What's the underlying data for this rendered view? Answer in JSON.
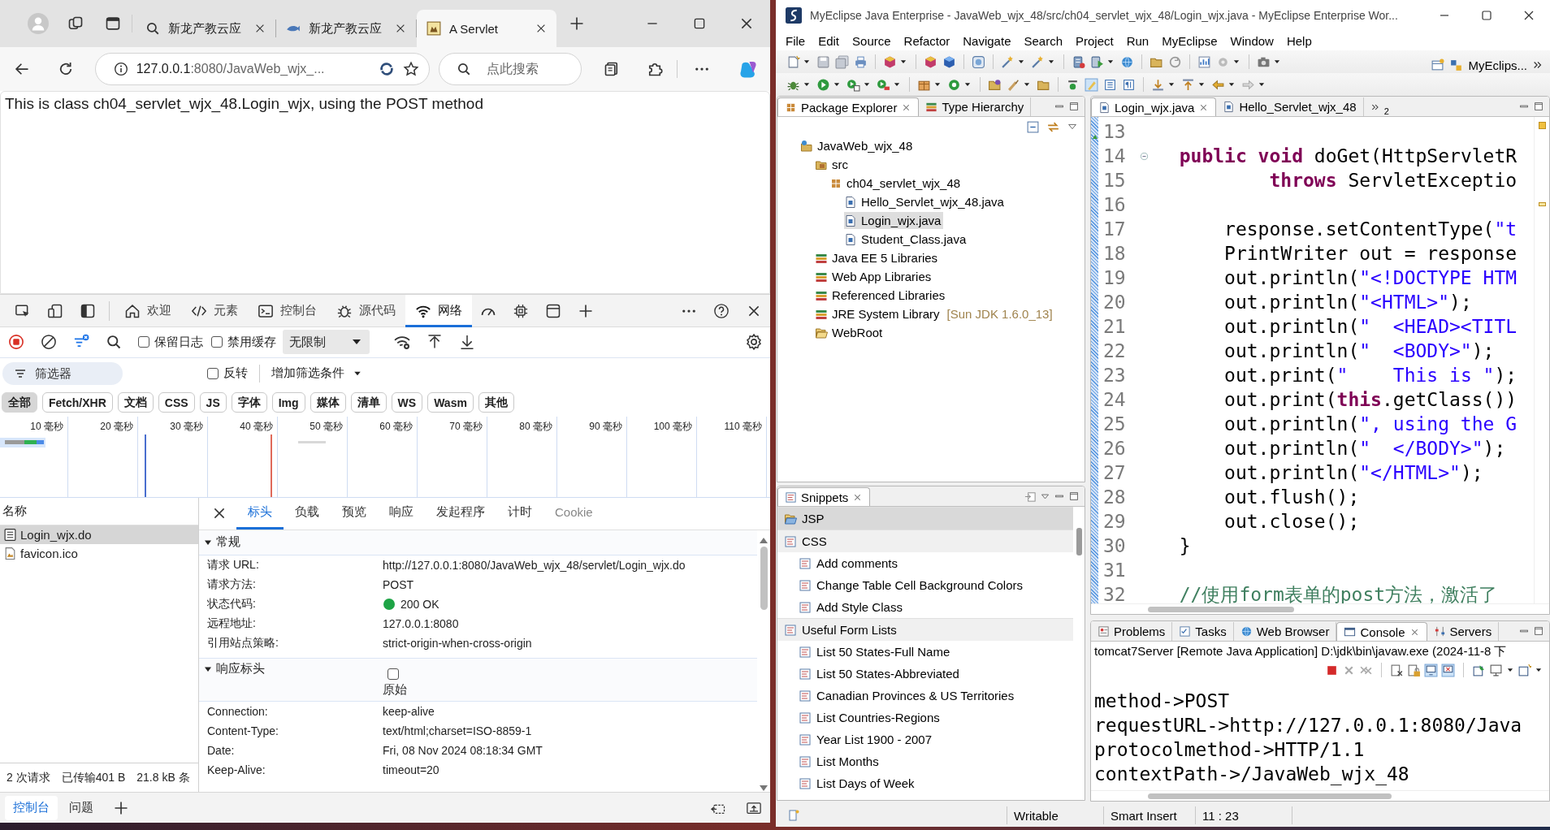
{
  "browser": {
    "tabs": [
      {
        "title": "新龙产教云应",
        "kind": "search",
        "selected": false
      },
      {
        "title": "新龙产教云应",
        "kind": "fish",
        "selected": false
      },
      {
        "title": "A Servlet",
        "kind": "favicon",
        "selected": true
      }
    ],
    "address": {
      "host": "127.0.0.1",
      "path": ":8080/JavaWeb_wjx_..."
    },
    "search": {
      "placeholder": "点此搜索"
    },
    "page_text": "This is class ch04_servlet_wjx_48.Login_wjx, using the POST method"
  },
  "devtools": {
    "tabs": [
      {
        "label": "欢迎",
        "kind": "home",
        "selected": false
      },
      {
        "label": "元素",
        "kind": "code",
        "selected": false
      },
      {
        "label": "控制台",
        "kind": "console",
        "selected": false
      },
      {
        "label": "源代码",
        "kind": "bug",
        "selected": false
      },
      {
        "label": "网络",
        "kind": "wifi",
        "selected": true
      }
    ],
    "preserve_log": {
      "label": "保留日志",
      "checked": false
    },
    "disable_cache": {
      "label": "禁用缓存",
      "checked": false
    },
    "throttling": "无限制",
    "filter": {
      "placeholder": "筛选器"
    },
    "invert": {
      "label": "反转",
      "checked": false
    },
    "more_filters": "增加筛选条件",
    "type_filters": [
      {
        "label": "全部",
        "selected": true
      },
      {
        "label": "Fetch/XHR",
        "selected": false
      },
      {
        "label": "文档",
        "selected": false
      },
      {
        "label": "CSS",
        "selected": false
      },
      {
        "label": "JS",
        "selected": false
      },
      {
        "label": "字体",
        "selected": false
      },
      {
        "label": "Img",
        "selected": false
      },
      {
        "label": "媒体",
        "selected": false
      },
      {
        "label": "清单",
        "selected": false
      },
      {
        "label": "WS",
        "selected": false
      },
      {
        "label": "Wasm",
        "selected": false
      },
      {
        "label": "其他",
        "selected": false
      }
    ],
    "timeline_ticks": [
      "10 毫秒",
      "20 毫秒",
      "30 毫秒",
      "40 毫秒",
      "50 毫秒",
      "60 毫秒",
      "70 毫秒",
      "80 毫秒",
      "90 毫秒",
      "100 毫秒",
      "110 毫秒"
    ],
    "name_header": "名称",
    "requests": [
      {
        "name": "Login_wjx.do",
        "kind": "document",
        "selected": true
      },
      {
        "name": "favicon.ico",
        "kind": "image",
        "selected": false
      }
    ],
    "detail_tabs": [
      {
        "label": "标头",
        "selected": true,
        "disabled": false
      },
      {
        "label": "负载",
        "selected": false,
        "disabled": false
      },
      {
        "label": "预览",
        "selected": false,
        "disabled": false
      },
      {
        "label": "响应",
        "selected": false,
        "disabled": false
      },
      {
        "label": "发起程序",
        "selected": false,
        "disabled": false
      },
      {
        "label": "计时",
        "selected": false,
        "disabled": false
      },
      {
        "label": "Cookie",
        "selected": false,
        "disabled": true
      }
    ],
    "general": {
      "title": "常规",
      "expanded": true,
      "rows": [
        {
          "key": "请求 URL:",
          "value": "http://127.0.0.1:8080/JavaWeb_wjx_48/servlet/Login_wjx.do",
          "kind": "text"
        },
        {
          "key": "请求方法:",
          "value": "POST",
          "kind": "text"
        },
        {
          "key": "状态代码:",
          "value": "200 OK",
          "kind": "status"
        },
        {
          "key": "远程地址:",
          "value": "127.0.0.1:8080",
          "kind": "text"
        },
        {
          "key": "引用站点策略:",
          "value": "strict-origin-when-cross-origin",
          "kind": "text"
        }
      ]
    },
    "response_headers": {
      "title": "响应标头",
      "expanded": true,
      "raw": {
        "label": "原始",
        "checked": false
      },
      "rows": [
        {
          "key": "Connection:",
          "value": "keep-alive"
        },
        {
          "key": "Content-Type:",
          "value": "text/html;charset=ISO-8859-1"
        },
        {
          "key": "Date:",
          "value": "Fri, 08 Nov 2024 08:18:34 GMT"
        },
        {
          "key": "Keep-Alive:",
          "value": "timeout=20"
        }
      ]
    },
    "summary": [
      "2 次请求",
      "已传输401 B",
      "21.8 kB 条"
    ],
    "drawer_tabs": [
      {
        "label": "控制台",
        "selected": true
      },
      {
        "label": "问题",
        "selected": false
      }
    ]
  },
  "ide": {
    "title": "MyEclipse Java Enterprise - JavaWeb_wjx_48/src/ch04_servlet_wjx_48/Login_wjx.java - MyEclipse Enterprise Wor...",
    "menu": [
      "File",
      "Edit",
      "Source",
      "Refactor",
      "Navigate",
      "Search",
      "Project",
      "Run",
      "MyEclipse",
      "Window",
      "Help"
    ],
    "perspective": "MyEclips...",
    "explorer_tabs": [
      {
        "label": "Package Explorer",
        "selected": true
      },
      {
        "label": "Type Hierarchy",
        "selected": false
      }
    ],
    "tree": [
      {
        "label": "JavaWeb_wjx_48",
        "kind": "project",
        "selected": false,
        "children": [
          {
            "label": "src",
            "kind": "source",
            "selected": false,
            "children": [
              {
                "label": "ch04_servlet_wjx_48",
                "kind": "package",
                "selected": false,
                "children": [
                  {
                    "label": "Hello_Servlet_wjx_48.java",
                    "kind": "java",
                    "selected": false
                  },
                  {
                    "label": "Login_wjx.java",
                    "kind": "java",
                    "selected": true
                  },
                  {
                    "label": "Student_Class.java",
                    "kind": "java",
                    "selected": false
                  }
                ]
              }
            ]
          },
          {
            "label": "Java EE 5 Libraries",
            "kind": "library",
            "selected": false
          },
          {
            "label": "Web App Libraries",
            "kind": "library",
            "selected": false
          },
          {
            "label": "Referenced Libraries",
            "kind": "library",
            "selected": false
          },
          {
            "label": "JRE System Library",
            "note": "[Sun JDK 1.6.0_13]",
            "kind": "library",
            "selected": false
          },
          {
            "label": "WebRoot",
            "kind": "folder",
            "selected": false
          }
        ]
      }
    ],
    "editor_tabs": [
      {
        "label": "Login_wjx.java",
        "selected": true
      },
      {
        "label": "Hello_Servlet_wjx_48",
        "selected": false
      }
    ],
    "hidden_tab_count": "2",
    "code": [
      {
        "number": "13"
      },
      {
        "number": "14",
        "segments": [
          {
            "kind": "keyword",
            "text": "  public void"
          },
          {
            "kind": "plain",
            "text": " doGet(HttpServletR"
          }
        ]
      },
      {
        "number": "15",
        "segments": [
          {
            "kind": "keyword",
            "text": "          throws"
          },
          {
            "kind": "plain",
            "text": " ServletExceptio"
          }
        ]
      },
      {
        "number": "16"
      },
      {
        "number": "17",
        "segments": [
          {
            "kind": "plain",
            "text": "      response.setContentType("
          },
          {
            "kind": "string",
            "text": "\"t"
          }
        ]
      },
      {
        "number": "18",
        "segments": [
          {
            "kind": "plain",
            "text": "      PrintWriter out = response"
          }
        ]
      },
      {
        "number": "19",
        "segments": [
          {
            "kind": "plain",
            "text": "      out.println("
          },
          {
            "kind": "string",
            "text": "\"<!DOCTYPE HTM"
          }
        ]
      },
      {
        "number": "20",
        "segments": [
          {
            "kind": "plain",
            "text": "      out.println("
          },
          {
            "kind": "string",
            "text": "\"<HTML>\""
          },
          {
            "kind": "plain",
            "text": ");"
          }
        ]
      },
      {
        "number": "21",
        "segments": [
          {
            "kind": "plain",
            "text": "      out.println("
          },
          {
            "kind": "string",
            "text": "\"  <HEAD><TITL"
          }
        ]
      },
      {
        "number": "22",
        "segments": [
          {
            "kind": "plain",
            "text": "      out.println("
          },
          {
            "kind": "string",
            "text": "\"  <BODY>\""
          },
          {
            "kind": "plain",
            "text": ");"
          }
        ]
      },
      {
        "number": "23",
        "segments": [
          {
            "kind": "plain",
            "text": "      out.print("
          },
          {
            "kind": "string",
            "text": "\"    This is \""
          },
          {
            "kind": "plain",
            "text": ");"
          }
        ]
      },
      {
        "number": "24",
        "segments": [
          {
            "kind": "plain",
            "text": "      out.print("
          },
          {
            "kind": "keyword",
            "text": "this"
          },
          {
            "kind": "plain",
            "text": ".getClass())"
          }
        ]
      },
      {
        "number": "25",
        "segments": [
          {
            "kind": "plain",
            "text": "      out.println("
          },
          {
            "kind": "string",
            "text": "\", using the G"
          }
        ]
      },
      {
        "number": "26",
        "segments": [
          {
            "kind": "plain",
            "text": "      out.println("
          },
          {
            "kind": "string",
            "text": "\"  </BODY>\""
          },
          {
            "kind": "plain",
            "text": ");"
          }
        ]
      },
      {
        "number": "27",
        "segments": [
          {
            "kind": "plain",
            "text": "      out.println("
          },
          {
            "kind": "string",
            "text": "\"</HTML>\""
          },
          {
            "kind": "plain",
            "text": ");"
          }
        ]
      },
      {
        "number": "28",
        "segments": [
          {
            "kind": "plain",
            "text": "      out.flush();"
          }
        ]
      },
      {
        "number": "29",
        "segments": [
          {
            "kind": "plain",
            "text": "      out.close();"
          }
        ]
      },
      {
        "number": "30",
        "segments": [
          {
            "kind": "plain",
            "text": "  }"
          }
        ]
      },
      {
        "number": "31"
      },
      {
        "number": "32",
        "segments": [
          {
            "kind": "comment",
            "text": "  //使用form表单的post方法，激活了"
          }
        ]
      }
    ],
    "snippets": {
      "title": "Snippets",
      "groups": [
        {
          "label": "JSP",
          "selected": true
        },
        {
          "label": "CSS",
          "selected": false,
          "items": [
            "Add comments",
            "Change Table Cell Background Colors",
            "Add Style Class"
          ]
        },
        {
          "label": "Useful Form Lists",
          "selected": false,
          "items": [
            "List 50 States-Full Name",
            "List 50 States-Abbreviated",
            "Canadian Provinces & US Territories",
            "List Countries-Regions",
            "Year List 1900 - 2007",
            "List Months",
            "List Days of Week"
          ]
        }
      ]
    },
    "console_tabs": [
      {
        "label": "Problems",
        "kind": "problems",
        "selected": false
      },
      {
        "label": "Tasks",
        "kind": "tasks",
        "selected": false
      },
      {
        "label": "Web Browser",
        "kind": "browser",
        "selected": false
      },
      {
        "label": "Console",
        "kind": "console",
        "selected": true
      },
      {
        "label": "Servers",
        "kind": "servers",
        "selected": false
      }
    ],
    "console_header": "tomcat7Server [Remote Java Application] D:\\jdk\\bin\\javaw.exe (2024-11-8 下",
    "console_lines": [
      "method->POST",
      "requestURL->http://127.0.0.1:8080/Java",
      "protocolmethod->HTTP/1.1",
      "contextPath->/JavaWeb_wjx_48"
    ],
    "status": [
      "Writable",
      "Smart Insert",
      "11 : 23"
    ]
  }
}
